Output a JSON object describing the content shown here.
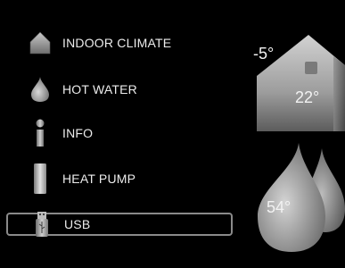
{
  "menu": {
    "items": [
      {
        "label": "INDOOR CLIMATE",
        "icon": "house-icon"
      },
      {
        "label": "HOT WATER",
        "icon": "water-drop-icon"
      },
      {
        "label": "INFO",
        "icon": "info-icon"
      },
      {
        "label": "HEAT PUMP",
        "icon": "heat-pump-icon"
      },
      {
        "label": "USB",
        "icon": "usb-icon"
      }
    ],
    "selected": "USB"
  },
  "status": {
    "outdoor_temp": "-5°",
    "indoor_temp": "22°",
    "hot_water_temp": "54°"
  },
  "colors": {
    "background": "#000000",
    "icon_gray": "#9a9a9a",
    "selection_border": "#8a8a8a"
  }
}
